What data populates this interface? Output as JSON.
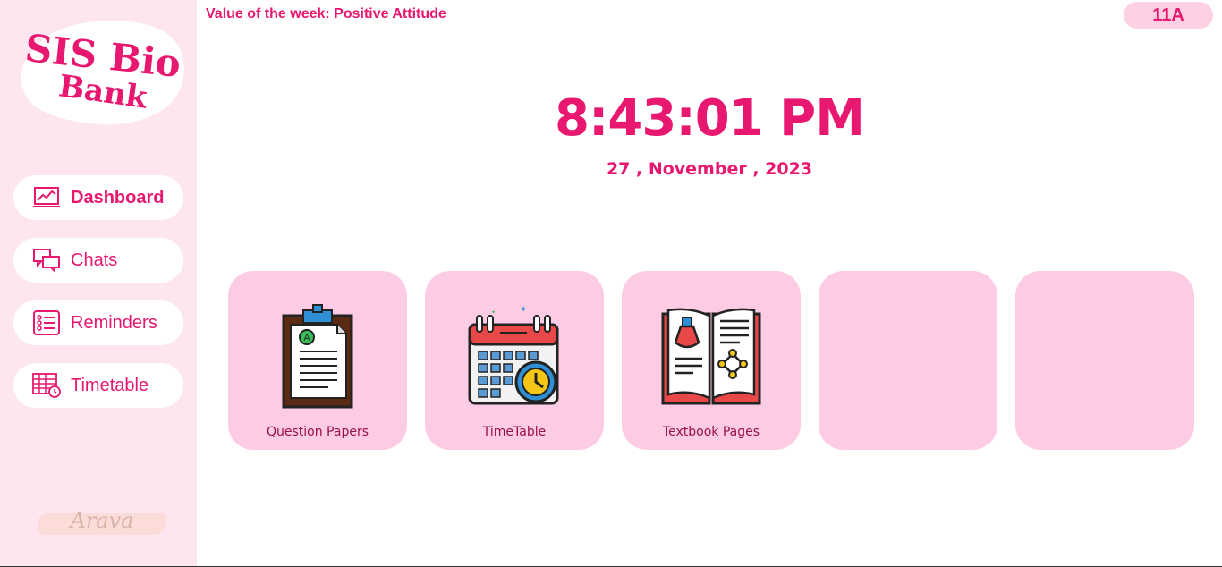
{
  "sidebar": {
    "logo": {
      "line1": "SIS Bio",
      "line2": "Bank"
    },
    "items": [
      {
        "label": "Dashboard",
        "icon": "chart-laptop-icon",
        "active": true
      },
      {
        "label": "Chats",
        "icon": "chat-bubbles-icon",
        "active": false
      },
      {
        "label": "Reminders",
        "icon": "list-icon",
        "active": false
      },
      {
        "label": "Timetable",
        "icon": "table-clock-icon",
        "active": false
      }
    ],
    "signature": "Arava"
  },
  "header": {
    "value_of_week": "Value of the week: Positive Attitude",
    "class_badge": "11A"
  },
  "clock": {
    "time": "8:43:01 PM",
    "date": "27 , November , 2023"
  },
  "tiles": [
    {
      "label": "Question Papers",
      "icon": "clipboard-exam-icon"
    },
    {
      "label": "TimeTable",
      "icon": "calendar-clock-icon"
    },
    {
      "label": "Textbook Pages",
      "icon": "science-book-icon"
    },
    {
      "label": "",
      "icon": ""
    },
    {
      "label": "",
      "icon": ""
    }
  ],
  "colors": {
    "accent": "#e8176f",
    "sidebar_bg": "#fde6ef",
    "tile_bg": "#fdcbe3",
    "tile_label": "#9b1150"
  }
}
